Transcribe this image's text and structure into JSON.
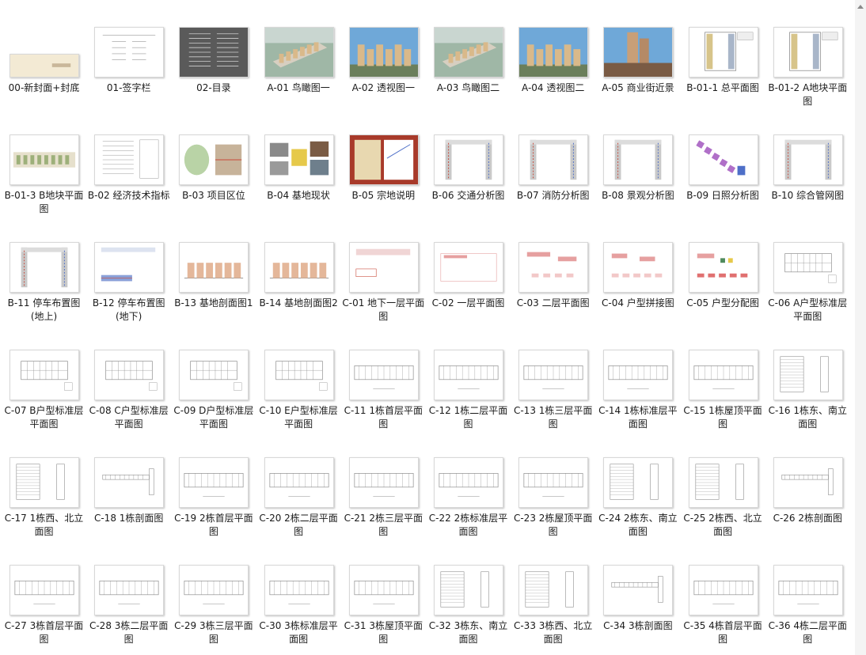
{
  "files": [
    {
      "label": "00-新封面+封底",
      "kind": "cover"
    },
    {
      "label": "01-签字栏",
      "kind": "form"
    },
    {
      "label": "02-目录",
      "kind": "dark"
    },
    {
      "label": "A-01 鸟瞰图一",
      "kind": "aerial"
    },
    {
      "label": "A-02 透视图一",
      "kind": "render"
    },
    {
      "label": "A-03 鸟瞰图二",
      "kind": "aerial"
    },
    {
      "label": "A-04 透视图二",
      "kind": "render"
    },
    {
      "label": "A-05 商业街近景",
      "kind": "street"
    },
    {
      "label": "B-01-1 总平面图",
      "kind": "siteplan"
    },
    {
      "label": "B-01-2 A地块平面图",
      "kind": "siteplan"
    },
    {
      "label": "B-01-3 B地块平面图",
      "kind": "stripplan"
    },
    {
      "label": "B-02 经济技术指标",
      "kind": "table"
    },
    {
      "label": "B-03 项目区位",
      "kind": "location"
    },
    {
      "label": "B-04 基地现状",
      "kind": "photos"
    },
    {
      "label": "B-05 宗地说明",
      "kind": "poster"
    },
    {
      "label": "B-06 交通分析图",
      "kind": "analysis"
    },
    {
      "label": "B-07 消防分析图",
      "kind": "analysis"
    },
    {
      "label": "B-08 景观分析图",
      "kind": "analysis"
    },
    {
      "label": "B-09 日照分析图",
      "kind": "sun"
    },
    {
      "label": "B-10 综合管网图",
      "kind": "analysis"
    },
    {
      "label": "B-11 停车布置图(地上)",
      "kind": "analysis"
    },
    {
      "label": "B-12 停车布置图(地下)",
      "kind": "parking"
    },
    {
      "label": "B-13 基地剖面图1",
      "kind": "section"
    },
    {
      "label": "B-14 基地剖面图2",
      "kind": "section"
    },
    {
      "label": "C-01 地下一层平面图",
      "kind": "basement"
    },
    {
      "label": "C-02 一层平面图",
      "kind": "floor"
    },
    {
      "label": "C-03 二层平面图",
      "kind": "floor2"
    },
    {
      "label": "C-04 户型拼接图",
      "kind": "units"
    },
    {
      "label": "C-05 户型分配图",
      "kind": "units2"
    },
    {
      "label": "C-06 A户型标准层平面图",
      "kind": "plan"
    },
    {
      "label": "C-07 B户型标准层平面图",
      "kind": "plan"
    },
    {
      "label": "C-08 C户型标准层平面图",
      "kind": "plan"
    },
    {
      "label": "C-09 D户型标准层平面图",
      "kind": "plan"
    },
    {
      "label": "C-10 E户型标准层平面图",
      "kind": "plan"
    },
    {
      "label": "C-11 1栋首层平面图",
      "kind": "wideplan"
    },
    {
      "label": "C-12 1栋二层平面图",
      "kind": "wideplan"
    },
    {
      "label": "C-13 1栋三层平面图",
      "kind": "wideplan"
    },
    {
      "label": "C-14 1栋标准层平面图",
      "kind": "wideplan"
    },
    {
      "label": "C-15 1栋屋顶平面图",
      "kind": "wideplan"
    },
    {
      "label": "C-16 1栋东、南立面图",
      "kind": "elevation"
    },
    {
      "label": "C-17 1栋西、北立面图",
      "kind": "elevation"
    },
    {
      "label": "C-18 1栋剖面图",
      "kind": "sectionb"
    },
    {
      "label": "C-19 2栋首层平面图",
      "kind": "wideplan"
    },
    {
      "label": "C-20 2栋二层平面图",
      "kind": "wideplan"
    },
    {
      "label": "C-21 2栋三层平面图",
      "kind": "wideplan"
    },
    {
      "label": "C-22 2栋标准层平面图",
      "kind": "wideplan"
    },
    {
      "label": "C-23 2栋屋顶平面图",
      "kind": "wideplan"
    },
    {
      "label": "C-24 2栋东、南立面图",
      "kind": "elevation"
    },
    {
      "label": "C-25 2栋西、北立面图",
      "kind": "elevation"
    },
    {
      "label": "C-26 2栋剖面图",
      "kind": "sectionb"
    },
    {
      "label": "C-27 3栋首层平面图",
      "kind": "wideplan"
    },
    {
      "label": "C-28 3栋二层平面图",
      "kind": "wideplan"
    },
    {
      "label": "C-29 3栋三层平面图",
      "kind": "wideplan"
    },
    {
      "label": "C-30 3栋标准层平面图",
      "kind": "wideplan"
    },
    {
      "label": "C-31 3栋屋顶平面图",
      "kind": "wideplan"
    },
    {
      "label": "C-32 3栋东、南立面图",
      "kind": "elevation"
    },
    {
      "label": "C-33 3栋西、北立面图",
      "kind": "elevation"
    },
    {
      "label": "C-34 3栋剖面图",
      "kind": "sectionb"
    },
    {
      "label": "C-35 4栋首层平面图",
      "kind": "wideplan"
    },
    {
      "label": "C-36 4栋二层平面图",
      "kind": "wideplan"
    }
  ],
  "colors": {
    "label_text": "#1a1a1a",
    "thumb_border": "#d8d8d8",
    "cover": "#f3ead4",
    "dark": "#5a5a5a",
    "sky": "#6fa8d8",
    "green": "#4f8a5c",
    "building": "#d9b98a",
    "line": "#8c8c8c",
    "red": "#c84a3a",
    "blue": "#4e6fc8"
  },
  "scrollbar": {
    "icon": "scroll-up-arrow-icon"
  }
}
